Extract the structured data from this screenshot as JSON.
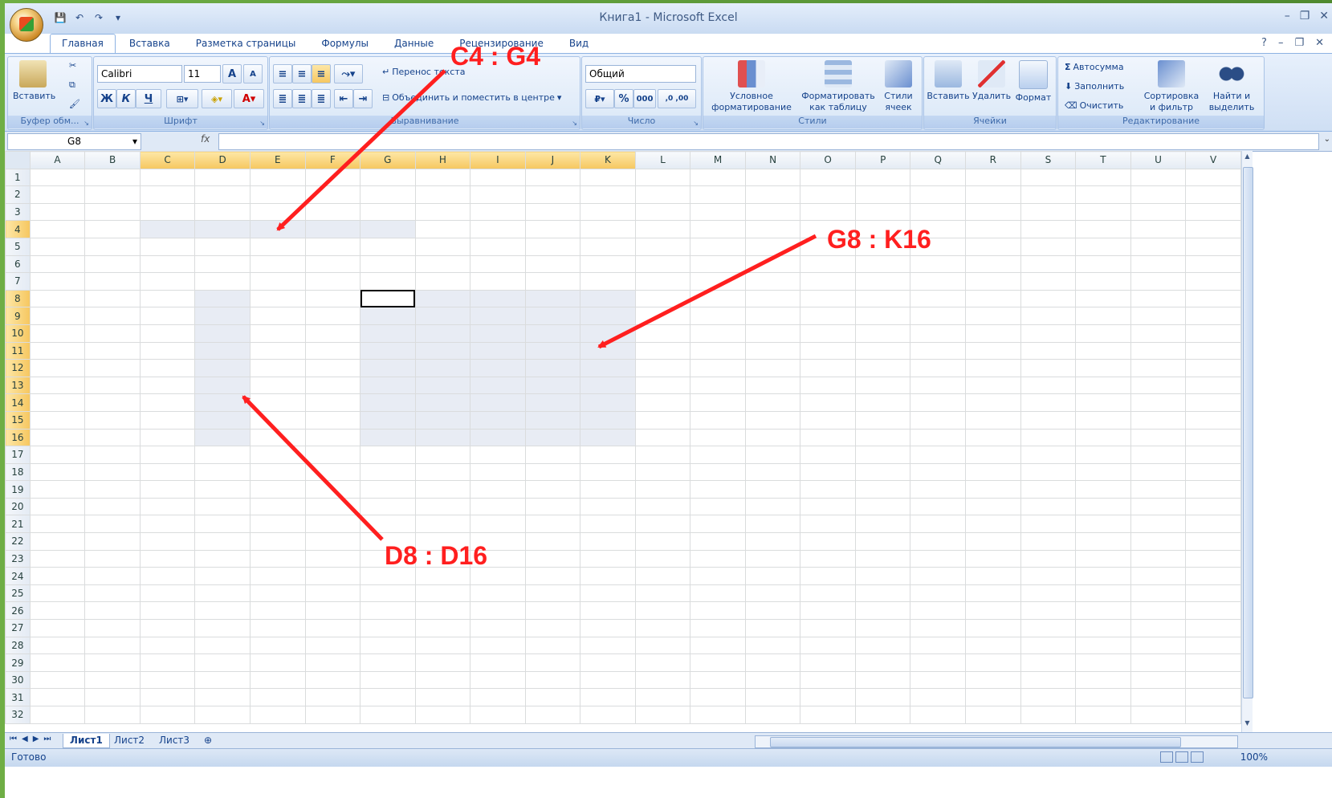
{
  "window": {
    "title": "Книга1 - Microsoft Excel",
    "controls": [
      "–",
      "❐",
      "✕"
    ]
  },
  "quick_access": [
    "💾",
    "↶",
    "↷",
    "▾"
  ],
  "ribbon_tabs": [
    "Главная",
    "Вставка",
    "Разметка страницы",
    "Формулы",
    "Данные",
    "Рецензирование",
    "Вид"
  ],
  "ribbon_right": [
    "?",
    "–",
    "❐",
    "✕"
  ],
  "clipboard": {
    "paste": "Вставить",
    "label": "Буфер обм..."
  },
  "font": {
    "name": "Calibri",
    "size": "11",
    "grow": "A",
    "shrink": "A",
    "bold": "Ж",
    "italic": "К",
    "underline": "Ч",
    "label": "Шрифт"
  },
  "alignment": {
    "wrap": "Перенос текста",
    "merge": "Объединить и поместить в центре",
    "label": "Выравнивание"
  },
  "number": {
    "format": "Общий",
    "percent": "%",
    "thousands": "000",
    "inc": ",0 ,00",
    "label": "Число"
  },
  "styles": {
    "conditional": "Условное форматирование",
    "as_table": "Форматировать как таблицу",
    "cell_styles": "Стили ячеек",
    "label": "Стили"
  },
  "cells": {
    "insert": "Вставить",
    "delete": "Удалить",
    "format": "Формат",
    "label": "Ячейки"
  },
  "editing": {
    "autosum": "Автосумма",
    "fill": "Заполнить",
    "clear": "Очистить",
    "sort": "Сортировка и фильтр",
    "find": "Найти и выделить",
    "label": "Редактирование"
  },
  "formula_bar": {
    "name_box": "G8",
    "fx": "fx",
    "value": ""
  },
  "columns": [
    "A",
    "B",
    "C",
    "D",
    "E",
    "F",
    "G",
    "H",
    "I",
    "J",
    "K",
    "L",
    "M",
    "N",
    "O",
    "P",
    "Q",
    "R",
    "S",
    "T",
    "U",
    "V"
  ],
  "rows": [
    "1",
    "2",
    "3",
    "4",
    "5",
    "6",
    "7",
    "8",
    "9",
    "10",
    "11",
    "12",
    "13",
    "14",
    "15",
    "16",
    "17",
    "18",
    "19",
    "20",
    "21",
    "22",
    "23",
    "24",
    "25",
    "26",
    "27",
    "28",
    "29",
    "30",
    "31",
    "32"
  ],
  "selected_columns": [
    "C",
    "D",
    "E",
    "F",
    "G",
    "H",
    "I",
    "J",
    "K"
  ],
  "selected_rows": [
    "4",
    "8",
    "9",
    "10",
    "11",
    "12",
    "13",
    "14",
    "15",
    "16"
  ],
  "active_cell": "G8",
  "sheets": [
    "Лист1",
    "Лист2",
    "Лист3"
  ],
  "status": {
    "ready": "Готово",
    "zoom": "100%"
  },
  "annotations": {
    "a1": "C4 : G4",
    "a2": "G8 : K16",
    "a3": "D8 : D16"
  },
  "annotation_color": "#ff1f1f"
}
